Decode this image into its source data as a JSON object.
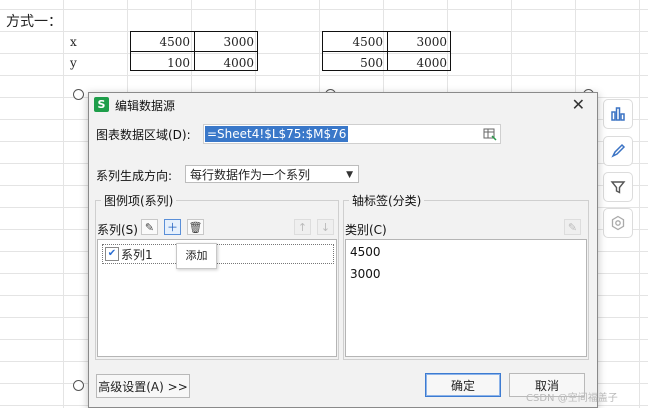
{
  "sheet": {
    "title": "方式一：",
    "table1": {
      "rows": [
        {
          "label": "x",
          "v1": "4500",
          "v2": "3000"
        },
        {
          "label": "y",
          "v1": "100",
          "v2": "4000"
        }
      ]
    },
    "table2": {
      "rows": [
        {
          "v1": "4500",
          "v2": "3000"
        },
        {
          "v1": "500",
          "v2": "4000"
        }
      ]
    }
  },
  "side_toolbar": [
    "chart-elements-icon",
    "chart-style-icon",
    "chart-filter-icon",
    "chart-settings-icon"
  ],
  "dialog": {
    "app_icon": "S",
    "title": "编辑数据源",
    "range_label": "图表数据区域(D):",
    "range_value": "=Sheet4!$L$75:$M$76",
    "direction_label": "系列生成方向:",
    "direction_value": "每行数据作为一个系列",
    "legend_group": "图例项(系列)",
    "series_label": "系列(S)",
    "series_items": [
      "系列1"
    ],
    "tooltip": "添加",
    "axis_group": "轴标签(分类)",
    "category_label": "类别(C)",
    "categories": [
      "4500",
      "3000"
    ],
    "advanced_button": "高级设置(A) >>",
    "ok_button": "确定",
    "cancel_button": "取消"
  },
  "watermark": "CSDN @空间福盖子",
  "colors": {
    "accent": "#3a78c9",
    "app_icon": "#1e9e4a"
  }
}
